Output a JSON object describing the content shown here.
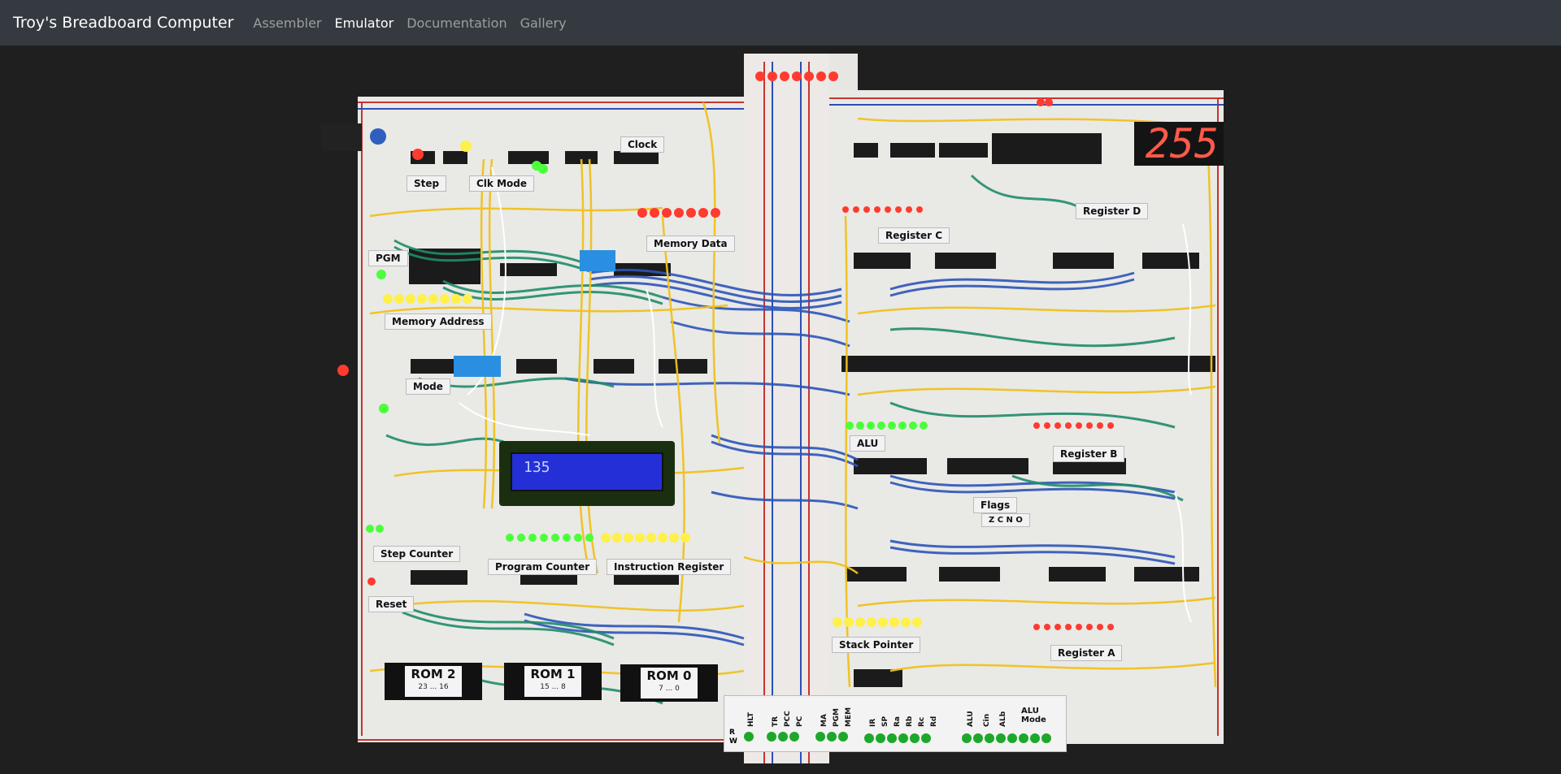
{
  "navbar": {
    "brand": "Troy's Breadboard Computer",
    "links": [
      {
        "label": "Assembler",
        "active": false
      },
      {
        "label": "Emulator",
        "active": true
      },
      {
        "label": "Documentation",
        "active": false
      },
      {
        "label": "Gallery",
        "active": false
      }
    ]
  },
  "board": {
    "display_value": "255",
    "lcd_text": "135",
    "labels": {
      "step": "Step",
      "clk_mode": "Clk Mode",
      "clock": "Clock",
      "memory_data": "Memory Data",
      "register_c": "Register C",
      "register_d": "Register D",
      "pgm": "PGM",
      "memory_address": "Memory Address",
      "mode": "Mode",
      "alu": "ALU",
      "register_b": "Register B",
      "flags": "Flags",
      "flag_letters": "Z C N O",
      "step_counter": "Step Counter",
      "program_counter": "Program Counter",
      "instruction_register": "Instruction Register",
      "reset": "Reset",
      "stack_pointer": "Stack Pointer",
      "register_a": "Register A"
    },
    "roms": [
      {
        "title": "ROM 2",
        "range": "23 ... 16"
      },
      {
        "title": "ROM 1",
        "range": "15 ... 8"
      },
      {
        "title": "ROM 0",
        "range": "7 ... 0"
      }
    ],
    "control_panel": {
      "rw": "R W",
      "signals": [
        "HLT",
        "TR",
        "PCC",
        "PC",
        "MA",
        "PGM",
        "MEM",
        "IR",
        "SP",
        "Ra",
        "Rb",
        "Rc",
        "Rd",
        "ALU",
        "Cin",
        "ALb"
      ],
      "alu_mode": "ALU Mode"
    },
    "colors": {
      "board": "#e9e9e6",
      "rail_red": "#c8342f",
      "rail_blue": "#2a4fb5",
      "wire_yellow": "#f0c21d",
      "wire_blue": "#2d55b8",
      "wire_green": "#1f8c6a",
      "led_red": "#ff3b2f",
      "led_green": "#4bff3a",
      "led_yellow": "#fff04a",
      "chip": "#1b1b1b"
    }
  }
}
